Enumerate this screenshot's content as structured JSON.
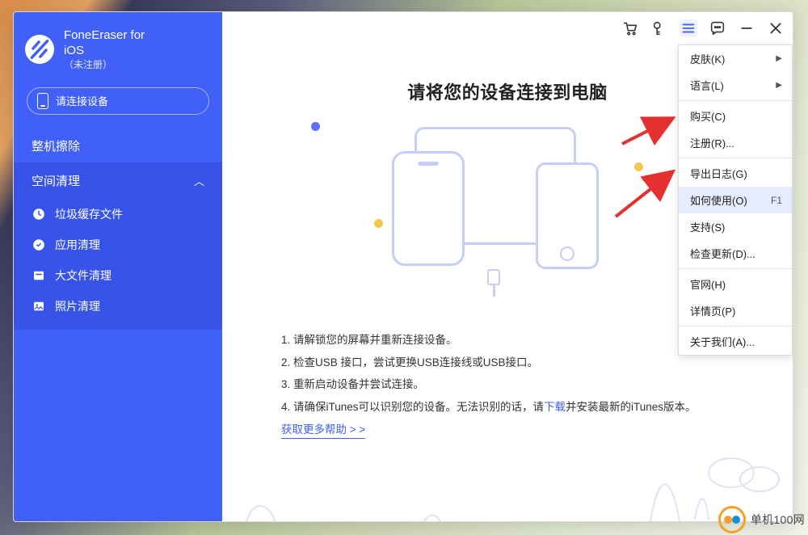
{
  "app": {
    "title_line1": "FoneEraser for",
    "title_line2": "iOS",
    "reg_status": "（未注册）"
  },
  "sidebar": {
    "connect_prompt": "请连接设备",
    "section_erase": "整机擦除",
    "section_clean": "空间清理",
    "items": [
      {
        "label": "垃圾缓存文件"
      },
      {
        "label": "应用清理"
      },
      {
        "label": "大文件清理"
      },
      {
        "label": "照片清理"
      }
    ]
  },
  "main": {
    "headline": "请将您的设备连接到电脑",
    "steps": {
      "s1": "1. 请解锁您的屏幕并重新连接设备。",
      "s2": "2. 检查USB 接口，尝试更换USB连接线或USB接口。",
      "s3": "3. 重新启动设备并尝试连接。",
      "s4_a": "4. 请确保iTunes可以识别您的设备。无法识别的话，请",
      "s4_link": "下载",
      "s4_b": "并安装最新的iTunes版本。"
    },
    "more_help": "获取更多帮助 > >"
  },
  "dropdown": {
    "items": [
      {
        "label": "皮肤(K)",
        "has_submenu": true
      },
      {
        "label": "语言(L)",
        "has_submenu": true
      },
      {
        "sep": true
      },
      {
        "label": "购买(C)"
      },
      {
        "label": "注册(R)..."
      },
      {
        "sep": true
      },
      {
        "label": "导出日志(G)"
      },
      {
        "label": "如何使用(O)",
        "shortcut": "F1",
        "highlight": true
      },
      {
        "label": "支持(S)"
      },
      {
        "label": "检查更新(D)..."
      },
      {
        "sep": true
      },
      {
        "label": "官网(H)"
      },
      {
        "label": "详情页(P)"
      },
      {
        "sep": true
      },
      {
        "label": "关于我们(A)..."
      }
    ]
  },
  "watermark": {
    "text": "单机100网"
  },
  "colors": {
    "primary": "#4060f8",
    "sidebar_dark": "#3854e8",
    "accent_yellow": "#f5c84b",
    "annotation_red": "#e53030"
  }
}
